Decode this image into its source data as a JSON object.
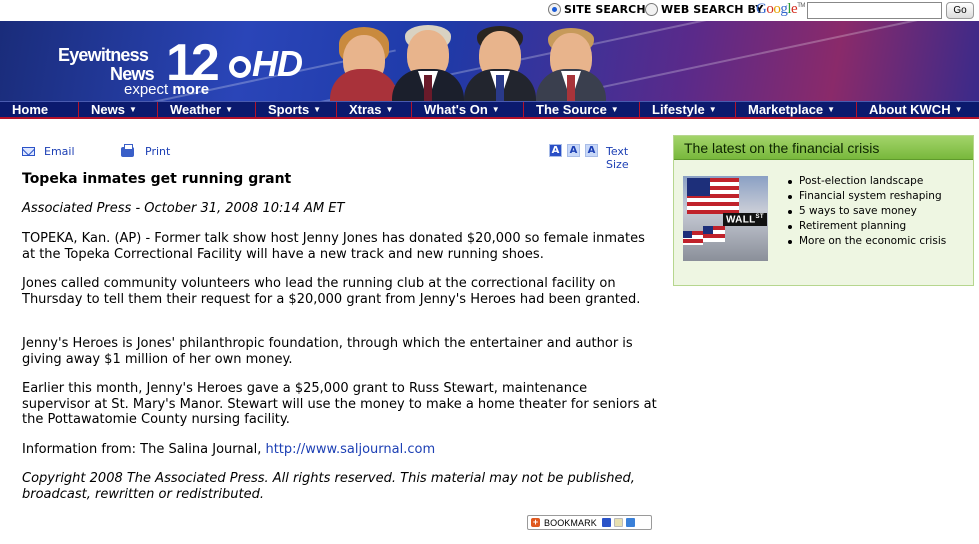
{
  "search": {
    "site_label": "SITE SEARCH",
    "web_label": "WEB SEARCH BY",
    "google_letters": [
      "G",
      "o",
      "o",
      "g",
      "l",
      "e"
    ],
    "google_tm": "TM",
    "input_value": "",
    "go_label": "Go"
  },
  "banner": {
    "logo_line1": "Eyewitness",
    "logo_line2": "News",
    "logo_number": "12",
    "logo_hd": "HD",
    "tagline_prefix": "expect ",
    "tagline_bold": "more"
  },
  "nav": [
    {
      "label": "Home",
      "caret": false
    },
    {
      "label": "News",
      "caret": true
    },
    {
      "label": "Weather",
      "caret": true
    },
    {
      "label": "Sports",
      "caret": true
    },
    {
      "label": "Xtras",
      "caret": true
    },
    {
      "label": "What's On",
      "caret": true
    },
    {
      "label": "The Source",
      "caret": true
    },
    {
      "label": "Lifestyle",
      "caret": true
    },
    {
      "label": "Marketplace",
      "caret": true
    },
    {
      "label": "About KWCH",
      "caret": true
    }
  ],
  "toolbar": {
    "email_label": "Email",
    "print_label": "Print",
    "size_letters": [
      "A",
      "A",
      "A"
    ],
    "size_selected": 0,
    "textsize_label": "Text Size"
  },
  "article": {
    "headline": "Topeka inmates get running grant",
    "byline": "Associated Press - October 31, 2008 10:14 AM ET",
    "paragraphs": [
      "TOPEKA, Kan. (AP) - Former talk show host Jenny Jones has donated $20,000 so female inmates at the Topeka Correctional Facility will have a new track and new running shoes.",
      "Jones called community volunteers who lead the running club at the correctional facility on Thursday to tell them their request for a $20,000 grant from Jenny's Heroes had been granted.",
      "Jenny's Heroes is Jones' philanthropic foundation, through which the entertainer and author is giving away $1 million of her own money.",
      "Earlier this month, Jenny's Heroes gave a $25,000 grant to Russ Stewart, maintenance supervisor at St. Mary's Manor. Stewart will use the money to make a home theater for seniors at the Pottawatomie County nursing facility."
    ],
    "info_prefix": "Information from: The Salina Journal, ",
    "info_link": "http://www.saljournal.com",
    "copyright": "Copyright 2008 The Associated Press. All rights reserved. This material may not be published, broadcast, rewritten or redistributed.",
    "bookmark_label": "BOOKMARK"
  },
  "sidebar": {
    "title": "The latest on the financial crisis",
    "photo_sign": "WALL",
    "photo_sign_sup": "ST",
    "items": [
      "Post-election landscape",
      "Financial system reshaping",
      "5 ways to save money",
      "Retirement planning",
      "More on the economic crisis"
    ]
  },
  "colors": {
    "nav_bg": "#0b1a6e",
    "nav_divider": "#b4122a",
    "link": "#1c3fb4",
    "sidebar_header": "#78b83c",
    "sidebar_bg": "#eef6e2"
  }
}
